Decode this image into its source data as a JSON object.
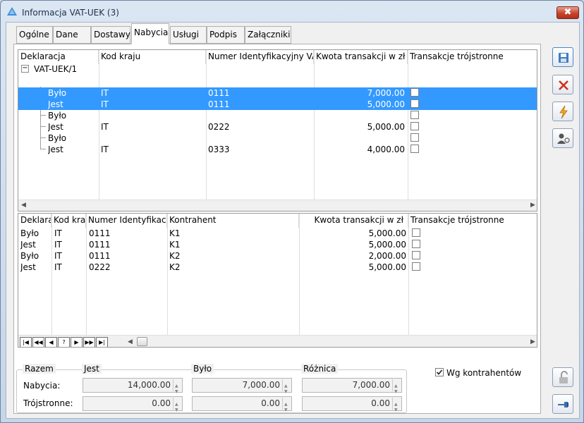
{
  "window": {
    "title": "Informacja VAT-UEK (3)",
    "close_glyph": "✖"
  },
  "tabs": [
    {
      "label": "Ogólne"
    },
    {
      "label": "Dane"
    },
    {
      "label": "Dostawy"
    },
    {
      "label": "Nabycia",
      "active": true
    },
    {
      "label": "Usługi"
    },
    {
      "label": "Podpis"
    },
    {
      "label": "Załączniki"
    }
  ],
  "upper_grid": {
    "headers": [
      "Deklaracja",
      "Kod kraju",
      "Numer Identyfikacyjny VA",
      "Kwota transakcji w zł",
      "Transakcje trójstronne"
    ],
    "root_label": "VAT-UEK/1",
    "rows": [
      {
        "decl": "Było",
        "country": "IT",
        "nip": "0111",
        "amount": "7,000.00",
        "selected": true
      },
      {
        "decl": "Jest",
        "country": "IT",
        "nip": "0111",
        "amount": "5,000.00",
        "selected": true
      },
      {
        "decl": "Było",
        "country": "",
        "nip": "",
        "amount": "",
        "selected": false
      },
      {
        "decl": "Jest",
        "country": "IT",
        "nip": "0222",
        "amount": "5,000.00",
        "selected": false
      },
      {
        "decl": "Było",
        "country": "",
        "nip": "",
        "amount": "",
        "selected": false
      },
      {
        "decl": "Jest",
        "country": "IT",
        "nip": "0333",
        "amount": "4,000.00",
        "selected": false
      }
    ]
  },
  "lower_grid": {
    "headers": [
      "Deklara",
      "Kod kra",
      "Numer Identyfikacy",
      "Kontrahent",
      "Kwota transakcji w zł",
      "Transakcje trójstronne"
    ],
    "rows": [
      {
        "decl": "Było",
        "country": "IT",
        "nip": "0111",
        "contractor": "K1",
        "amount": "5,000.00"
      },
      {
        "decl": "Jest",
        "country": "IT",
        "nip": "0111",
        "contractor": "K1",
        "amount": "5,000.00"
      },
      {
        "decl": "Było",
        "country": "IT",
        "nip": "0111",
        "contractor": "K2",
        "amount": "2,000.00"
      },
      {
        "decl": "Jest",
        "country": "IT",
        "nip": "0222",
        "contractor": "K2",
        "amount": "5,000.00"
      }
    ],
    "nav_buttons": [
      "|◀",
      "◀◀",
      "◀",
      "?",
      "▶",
      "▶▶",
      "▶|"
    ]
  },
  "by_contractors": {
    "label": "Wg kontrahentów",
    "checked": true
  },
  "summary": {
    "group_label": "Razem",
    "col_jest": "Jest",
    "col_bylo": "Było",
    "col_roznica": "Różnica",
    "rows": [
      {
        "label": "Nabycia:",
        "jest": "14,000.00",
        "bylo": "7,000.00",
        "roznica": "7,000.00"
      },
      {
        "label": "Trójstronne:",
        "jest": "0.00",
        "bylo": "0.00",
        "roznica": "0.00"
      }
    ]
  },
  "side_toolbar": {
    "icons": [
      "save-icon",
      "delete-icon",
      "calculate-icon",
      "user-settings-icon",
      "unlock-icon",
      "pin-icon"
    ]
  },
  "colors": {
    "selection": "#3399ff",
    "window_frame": "#c6d5e8"
  }
}
